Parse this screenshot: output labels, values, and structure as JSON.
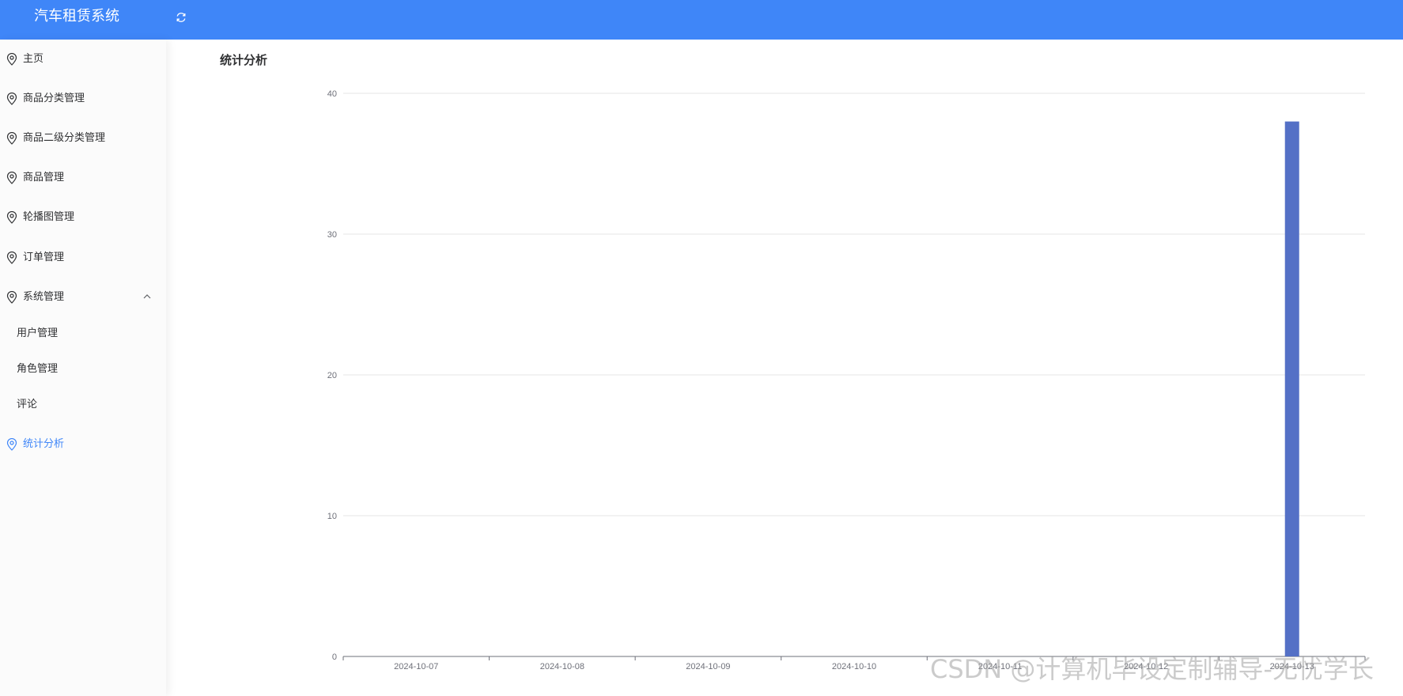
{
  "header": {
    "app_title": "汽车租赁系统",
    "refresh_icon": "refresh-icon"
  },
  "sidebar": {
    "items": [
      {
        "label": "主页",
        "icon": "location-pin-icon"
      },
      {
        "label": "商品分类管理",
        "icon": "location-pin-icon"
      },
      {
        "label": "商品二级分类管理",
        "icon": "location-pin-icon"
      },
      {
        "label": "商品管理",
        "icon": "location-pin-icon"
      },
      {
        "label": "轮播图管理",
        "icon": "location-pin-icon"
      },
      {
        "label": "订单管理",
        "icon": "location-pin-icon"
      },
      {
        "label": "系统管理",
        "icon": "location-pin-icon",
        "expanded": true
      }
    ],
    "submenu": [
      {
        "label": "用户管理"
      },
      {
        "label": "角色管理"
      },
      {
        "label": "评论"
      }
    ],
    "active_item": {
      "label": "统计分析",
      "icon": "location-pin-icon"
    },
    "active_color": "#3f86f8"
  },
  "main": {
    "page_title": "统计分析"
  },
  "chart_data": {
    "type": "bar",
    "categories": [
      "2024-10-07",
      "2024-10-08",
      "2024-10-09",
      "2024-10-10",
      "2024-10-11",
      "2024-10-12",
      "2024-10-13"
    ],
    "values": [
      0,
      0,
      0,
      0,
      0,
      0,
      38
    ],
    "y_ticks": [
      0,
      10,
      20,
      30,
      40
    ],
    "ylim": [
      0,
      40
    ],
    "bar_color": "#5470c6",
    "grid": true
  },
  "watermark": "CSDN @计算机毕设定制辅导-无忧学长"
}
